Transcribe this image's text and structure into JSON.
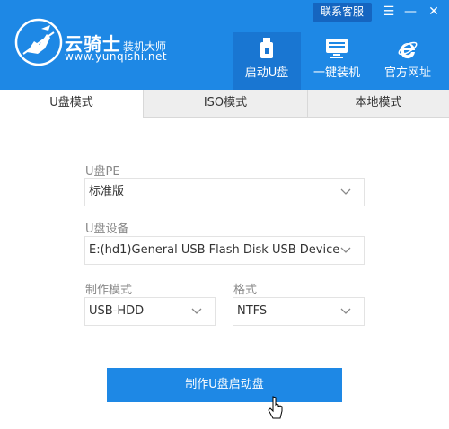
{
  "header": {
    "brand_name": "云骑士",
    "brand_suffix": "装机大师",
    "brand_url": "www.yunqishi.net",
    "support_label": "联系客服",
    "menu_glyph": "☰",
    "minimize_glyph": "—",
    "close_glyph": "✕",
    "nav": [
      {
        "label": "启动U盘",
        "icon": "usb-drive-icon",
        "active": true
      },
      {
        "label": "一键装机",
        "icon": "monitor-icon",
        "active": false
      },
      {
        "label": "官方网址",
        "icon": "ie-browser-icon",
        "active": false
      }
    ]
  },
  "tabs": [
    {
      "label": "U盘模式",
      "active": true
    },
    {
      "label": "ISO模式",
      "active": false
    },
    {
      "label": "本地模式",
      "active": false
    }
  ],
  "form": {
    "pe_label": "U盘PE",
    "pe_value": "标准版",
    "device_label": "U盘设备",
    "device_value": "E:(hd1)General USB Flash Disk USB Device",
    "mode_label": "制作模式",
    "mode_value": "USB-HDD",
    "format_label": "格式",
    "format_value": "NTFS"
  },
  "action": {
    "create_label": "制作U盘启动盘"
  },
  "colors": {
    "primary": "#1e88e5",
    "support_bg": "#1565c0",
    "tab_bg": "#eeeeee"
  }
}
